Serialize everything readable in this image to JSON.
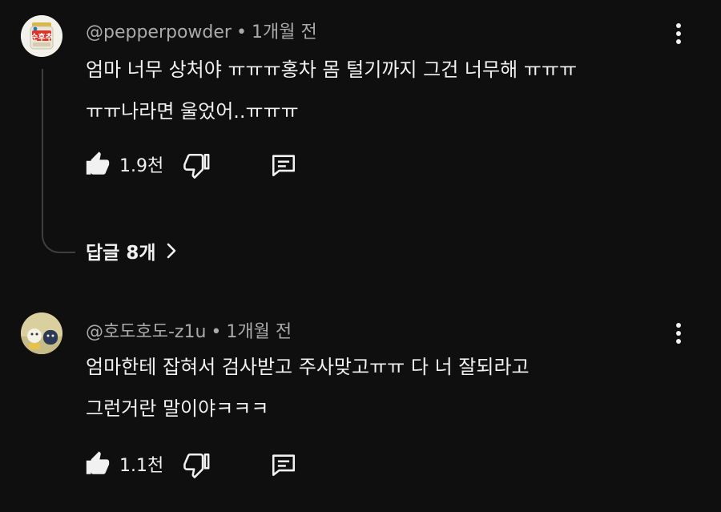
{
  "comments": [
    {
      "author": "@pepperpowder",
      "separator": "•",
      "time": "1개월 전",
      "lines": [
        "엄마 너무 상처야 ㅠㅠㅠ홍차 몸 털기까지 그건 너무해 ㅠㅠㅠ",
        "ㅠㅠ나라면 울었어..ㅠㅠㅠ"
      ],
      "likes": "1.9천",
      "replies_label": "답글 8개",
      "avatar_text": "순후추",
      "avatar_icon": "pepper-shaker-logo"
    },
    {
      "author": "@호도호도-z1u",
      "separator": "•",
      "time": "1개월 전",
      "lines": [
        "엄마한테 잡혀서 검사받고 주사맞고ㅠㅠ 다 너 잘되라고",
        "그런거란 말이야ㅋㅋㅋ"
      ],
      "likes": "1.1천",
      "avatar_icon": "cartoon-avatar"
    }
  ],
  "icons": {
    "like": "thumbs-up-icon",
    "dislike": "thumbs-down-icon",
    "reply": "comment-icon",
    "more": "kebab-menu-icon",
    "expand": "chevron-right-icon"
  },
  "colors": {
    "background": "#0f0f0f",
    "primary_text": "#f1f1f1",
    "secondary_text": "#aaaaaa",
    "thread_line": "#3f3f3f"
  }
}
